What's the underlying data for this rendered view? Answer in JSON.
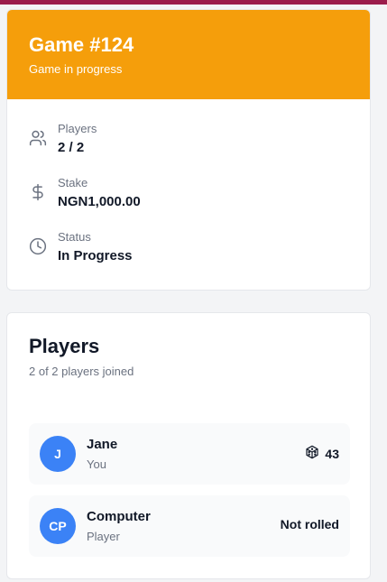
{
  "game": {
    "title": "Game #124",
    "subtitle": "Game in progress",
    "header_color": "#f59e0b",
    "info": [
      {
        "icon": "users-icon",
        "label": "Players",
        "value": "2 / 2"
      },
      {
        "icon": "dollar-icon",
        "label": "Stake",
        "value": "NGN1,000.00"
      },
      {
        "icon": "clock-icon",
        "label": "Status",
        "value": "In Progress"
      }
    ]
  },
  "players_section": {
    "title": "Players",
    "subtitle": "2 of 2 players joined",
    "players": [
      {
        "initials": "J",
        "name": "Jane",
        "role": "You",
        "result_icon": "dice-icon",
        "result": "43"
      },
      {
        "initials": "CP",
        "name": "Computer",
        "role": "Player",
        "result": "Not rolled"
      }
    ]
  }
}
